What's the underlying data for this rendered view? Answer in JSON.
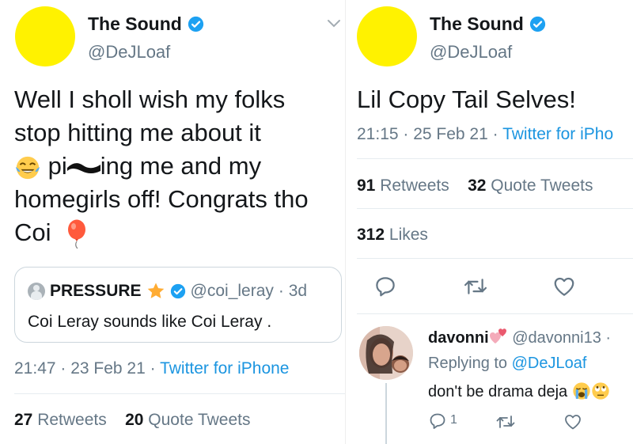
{
  "left_tweet": {
    "author": {
      "name": "The Sound",
      "handle": "@DeJLoaf"
    },
    "text_lines": [
      "Well I sholl wish my folks",
      "stop hitting me about it",
      "ing me and my",
      "homegirls off! Congrats tho",
      "Coi"
    ],
    "text_prefix_line3": "pi",
    "quoted": {
      "name": "PRESSURE",
      "handle": "@coi_leray",
      "time": "· 3d",
      "text": "Coi Leray sounds like Coi Leray ."
    },
    "meta": {
      "time": "21:47 · 23 Feb 21 · ",
      "source": "Twitter for iPhone"
    },
    "stats": {
      "retweets_count": "27",
      "retweets_label": "Retweets",
      "quotes_count": "20",
      "quotes_label": "Quote Tweets"
    }
  },
  "right_tweet": {
    "author": {
      "name": "The Sound",
      "handle": "@DeJLoaf"
    },
    "text": "Lil Copy Tail Selves!",
    "meta": {
      "time": "21:15 · 25 Feb 21 · ",
      "source": "Twitter for iPho"
    },
    "stats": {
      "retweets_count": "91",
      "retweets_label": "Retweets",
      "quotes_count": "32",
      "quotes_label": "Quote Tweets",
      "likes_count": "312",
      "likes_label": "Likes"
    }
  },
  "reply": {
    "name": "davonni",
    "handle": "@davonni13 ·",
    "replying_label": "Replying to ",
    "replying_handle": "@DeJLoaf",
    "text": "don't be drama deja",
    "reply_count": "1"
  },
  "icons": {
    "verified": "verified-badge-icon",
    "chevron": "chevron-down-icon",
    "laughing": "tears-of-joy-emoji",
    "balloon": "balloon-emoji",
    "star": "star-emoji",
    "hearts": "two-hearts-emoji",
    "crying": "loudly-crying-emoji",
    "eye_roll": "eye-roll-emoji",
    "reply": "reply-icon",
    "retweet": "retweet-icon",
    "like": "heart-icon"
  },
  "colors": {
    "accent": "#1b95e0",
    "verified": "#1da1f2",
    "avatar": "#fff200"
  }
}
